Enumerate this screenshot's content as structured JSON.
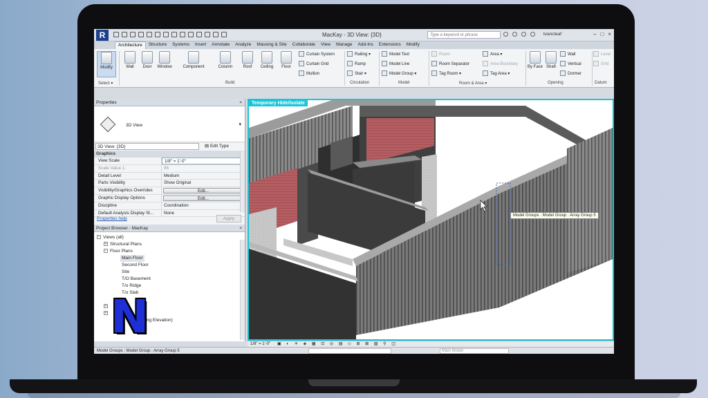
{
  "window": {
    "title": "MacKay - 3D View: {3D}",
    "search_placeholder": "Type a keyword or phrase",
    "user": "tvancleaf"
  },
  "tabs": [
    "Architecture",
    "Structure",
    "Systems",
    "Insert",
    "Annotate",
    "Analyze",
    "Massing & Site",
    "Collaborate",
    "View",
    "Manage",
    "Add-Ins",
    "Extensions",
    "Modify"
  ],
  "ribbon": {
    "modify": "Modify",
    "select": "Select",
    "build": {
      "label": "Build",
      "buttons": [
        "Wall",
        "Door",
        "Window",
        "Component",
        "Column",
        "Roof",
        "Ceiling",
        "Floor"
      ],
      "small": [
        "Curtain System",
        "Curtain Grid",
        "Mullion"
      ]
    },
    "circulation": {
      "label": "Circulation",
      "items": [
        "Railing",
        "Ramp",
        "Stair"
      ]
    },
    "model": {
      "label": "Model",
      "items": [
        "Model Text",
        "Model Line",
        "Model Group"
      ]
    },
    "room_area": {
      "label": "Room & Area",
      "items": [
        "Room",
        "Room Separator",
        "Tag Room",
        "Area",
        "Area Boundary",
        "Tag Area"
      ]
    },
    "opening": {
      "label": "Opening",
      "items": [
        "By Face",
        "Shaft",
        "Wall",
        "Vertical",
        "Dormer"
      ]
    },
    "datum": {
      "label": "Datum",
      "items": [
        "Level",
        "Grid"
      ]
    }
  },
  "properties": {
    "title": "Properties",
    "type_name": "3D View",
    "view_selector": "3D View: {3D}",
    "edit_type": "Edit Type",
    "group": "Graphics",
    "rows": [
      {
        "key": "View Scale",
        "value": "1/8\" = 1'-0\""
      },
      {
        "key": "Scale Value 1:",
        "value": "96"
      },
      {
        "key": "Detail Level",
        "value": "Medium"
      },
      {
        "key": "Parts Visibility",
        "value": "Show Original"
      },
      {
        "key": "Visibility/Graphics Overrides",
        "value": "Edit..."
      },
      {
        "key": "Graphic Display Options",
        "value": "Edit..."
      },
      {
        "key": "Discipline",
        "value": "Coordination"
      },
      {
        "key": "Default Analysis Display St...",
        "value": "None"
      }
    ],
    "help": "Properties help",
    "apply": "Apply"
  },
  "browser": {
    "title": "Project Browser - MacKay",
    "items": [
      "Views (all)",
      "Structural Plans",
      "Floor Plans",
      "Main Floor",
      "Second Floor",
      "Site",
      "T/O Basement",
      "T/o Ridge",
      "T/o Slab",
      "Building Elevation)"
    ]
  },
  "viewport": {
    "label": "Temporary Hide/Isolate",
    "tooltip": "Model Groups : Model Group : Array Group 5",
    "scale": "1/8\" = 1'-0\""
  },
  "status": {
    "text": "Model Groups : Model Group : Array Group 5",
    "model": "Main Model"
  },
  "overlay_logo": "N",
  "colors": {
    "accent": "#19c6d8",
    "brand": "#1c3f8c",
    "logo": "#1f2fd8"
  }
}
